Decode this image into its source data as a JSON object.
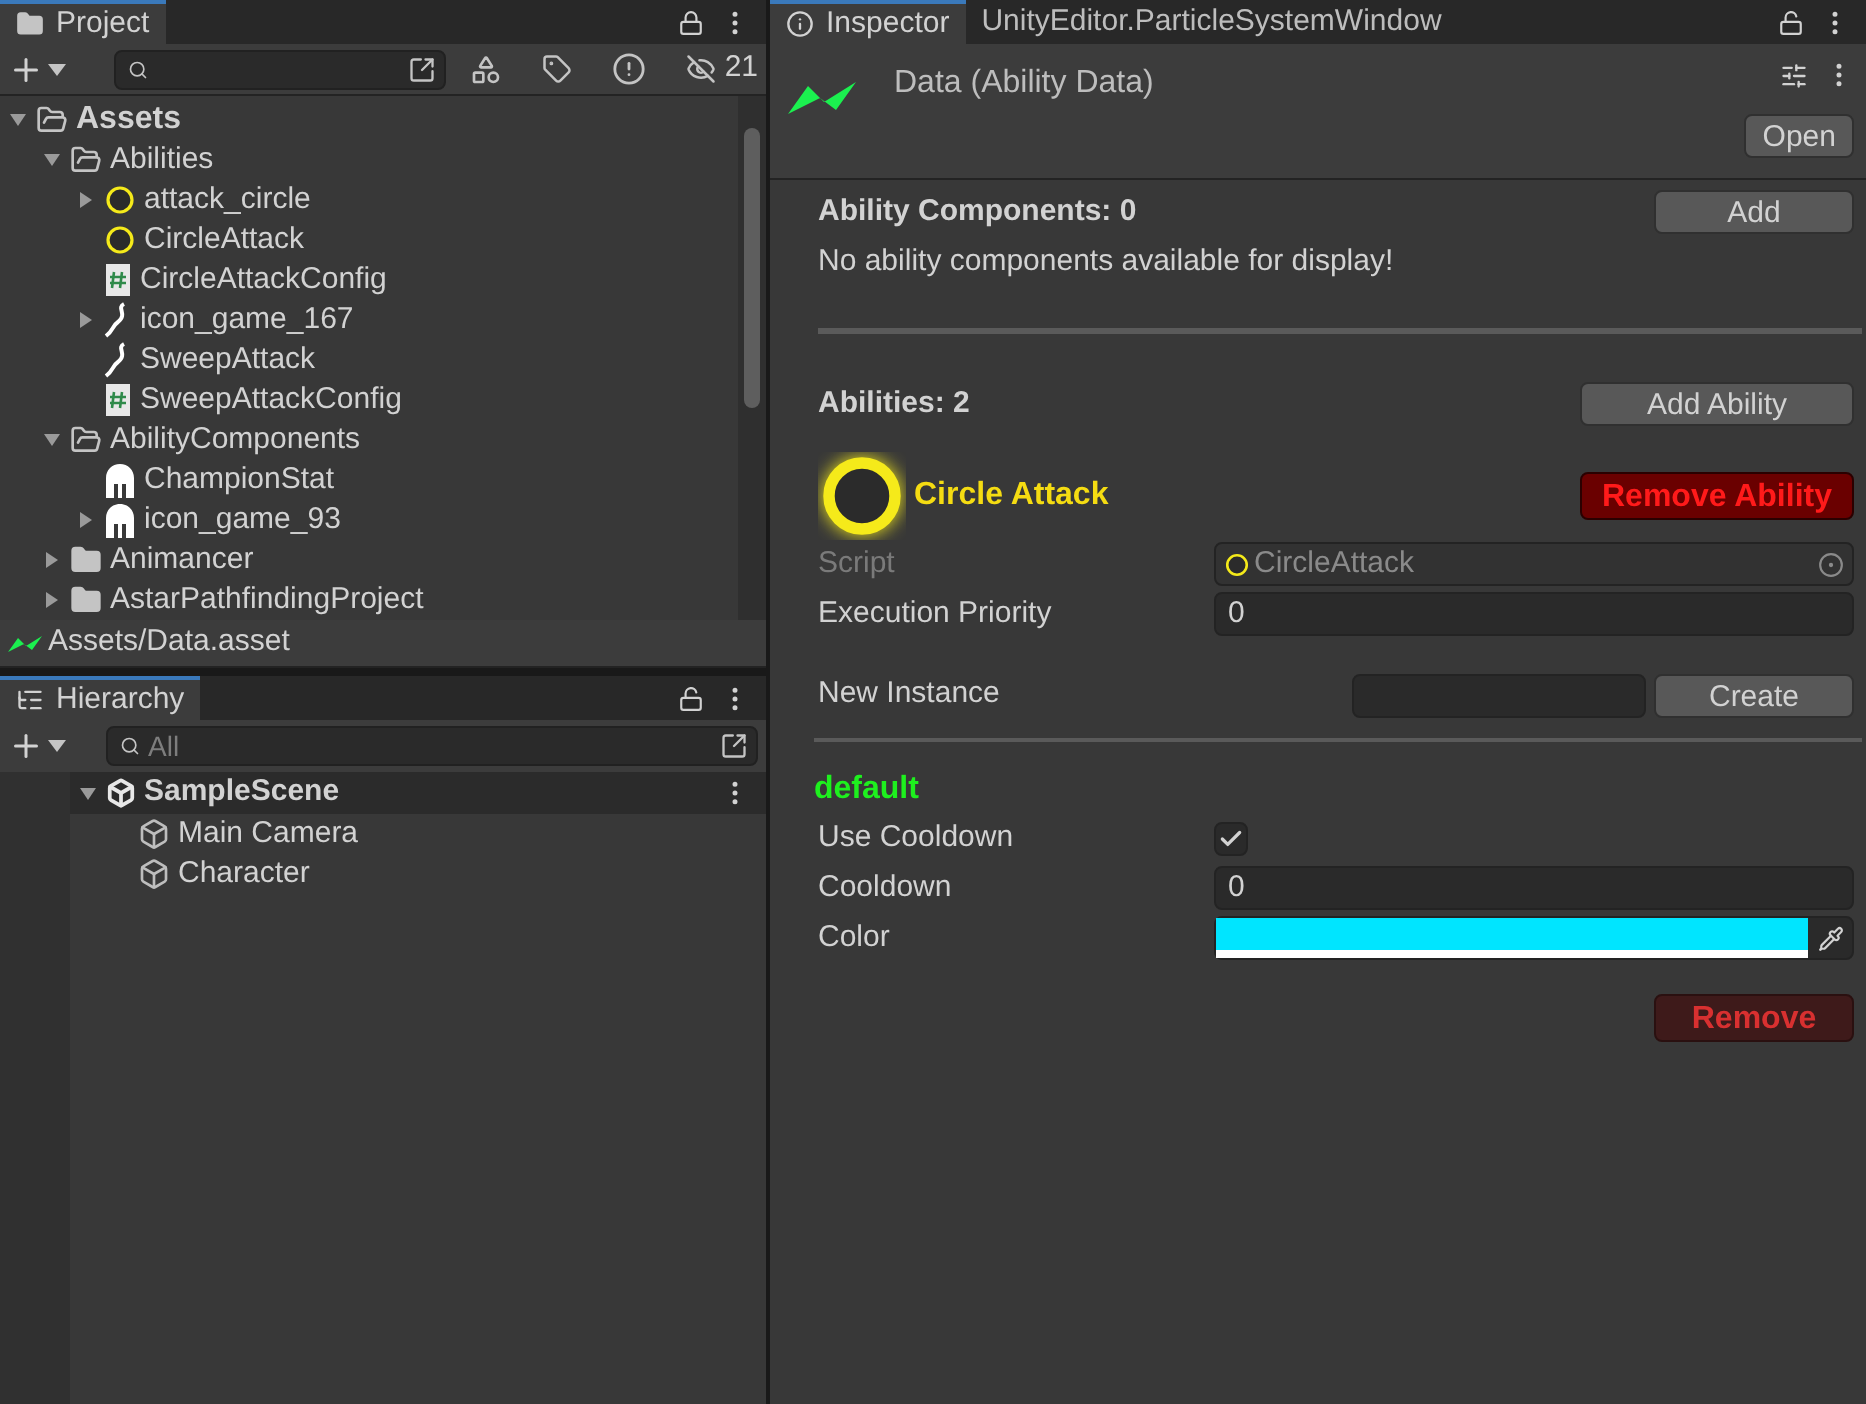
{
  "project": {
    "tab": {
      "label": "Project",
      "selected": true
    },
    "hidden_count": "21",
    "tree": [
      {
        "label": "Assets",
        "kind": "folder",
        "expanded": true,
        "bold": true,
        "children": [
          {
            "label": "Abilities",
            "kind": "folder",
            "expanded": true,
            "children": [
              {
                "label": "attack_circle",
                "kind": "ring",
                "expanded": false
              },
              {
                "label": "CircleAttack",
                "kind": "ring"
              },
              {
                "label": "CircleAttackConfig",
                "kind": "script"
              },
              {
                "label": "icon_game_167",
                "kind": "sweep",
                "expanded": false
              },
              {
                "label": "SweepAttack",
                "kind": "sweep"
              },
              {
                "label": "SweepAttackConfig",
                "kind": "script"
              }
            ]
          },
          {
            "label": "AbilityComponents",
            "kind": "folder",
            "expanded": true,
            "children": [
              {
                "label": "ChampionStat",
                "kind": "helmet"
              },
              {
                "label": "icon_game_93",
                "kind": "helmet",
                "expanded": false
              }
            ]
          },
          {
            "label": "Animancer",
            "kind": "folder",
            "expanded": false
          },
          {
            "label": "AstarPathfindingProject",
            "kind": "folder",
            "expanded": false
          }
        ]
      }
    ],
    "status_path": "Assets/Data.asset"
  },
  "hierarchy": {
    "tab": {
      "label": "Hierarchy",
      "selected": true
    },
    "search": {
      "placeholder": "All"
    },
    "scene": {
      "label": "SampleScene",
      "expanded": true,
      "children": [
        {
          "label": "Main Camera"
        },
        {
          "label": "Character"
        }
      ]
    }
  },
  "inspector": {
    "tabs": [
      {
        "label": "Inspector",
        "selected": true
      },
      {
        "label": "UnityEditor.ParticleSystemWindow",
        "selected": false
      }
    ],
    "title": "Data (Ability Data)",
    "open_button": "Open",
    "components": {
      "heading": "Ability Components: 0",
      "add_button": "Add",
      "empty_message": "No ability components available for display!"
    },
    "abilities": {
      "heading": "Abilities: 2",
      "add_button": "Add Ability",
      "ability": {
        "name": "Circle Attack",
        "remove_button": "Remove Ability",
        "fields": [
          {
            "label": "Script",
            "kind": "object",
            "value": "CircleAttack",
            "disabled": true
          },
          {
            "label": "Execution Priority",
            "kind": "text",
            "value": "0",
            "disabled": false
          }
        ],
        "new_instance": {
          "label": "New Instance",
          "button": "Create"
        },
        "section": "default",
        "settings": [
          {
            "label": "Use Cooldown",
            "kind": "checkbox",
            "checked": true
          },
          {
            "label": "Cooldown",
            "kind": "text",
            "value": "0"
          },
          {
            "label": "Color",
            "kind": "color",
            "color": "#00e5ff",
            "level": 1
          }
        ],
        "remove": {
          "label": "Remove",
          "disabled": true
        }
      }
    }
  }
}
